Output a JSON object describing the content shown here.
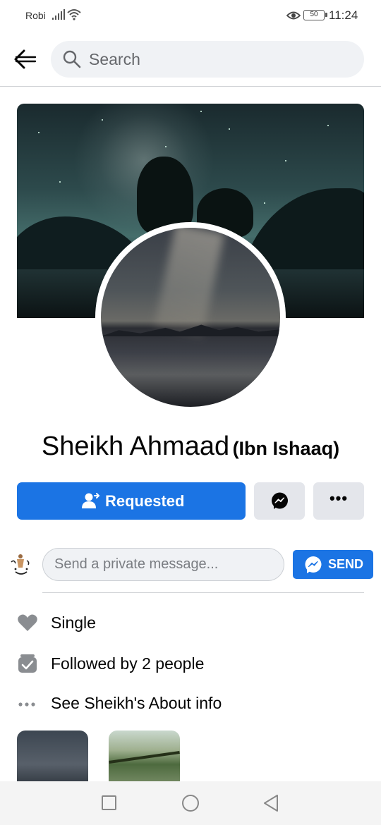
{
  "status_bar": {
    "carrier": "Robi",
    "battery": "50",
    "time": "11:24"
  },
  "header": {
    "back_icon": "back-arrow-icon",
    "search_placeholder": "Search"
  },
  "profile": {
    "name": "Sheikh Ahmaad",
    "nickname": "(Ibn Ishaaq)"
  },
  "actions": {
    "requested_label": "Requested",
    "more_label": "•••"
  },
  "private_message": {
    "placeholder": "Send a private message...",
    "send_label": "SEND"
  },
  "info": [
    {
      "icon": "heart-icon",
      "text": "Single"
    },
    {
      "icon": "followers-icon",
      "text": "Followed by 2 people"
    },
    {
      "icon": "more-dots-icon",
      "text": "See Sheikh's About info"
    }
  ],
  "colors": {
    "accent": "#1b74e4",
    "secondary_button": "#e4e6eb",
    "text": "#050505"
  }
}
